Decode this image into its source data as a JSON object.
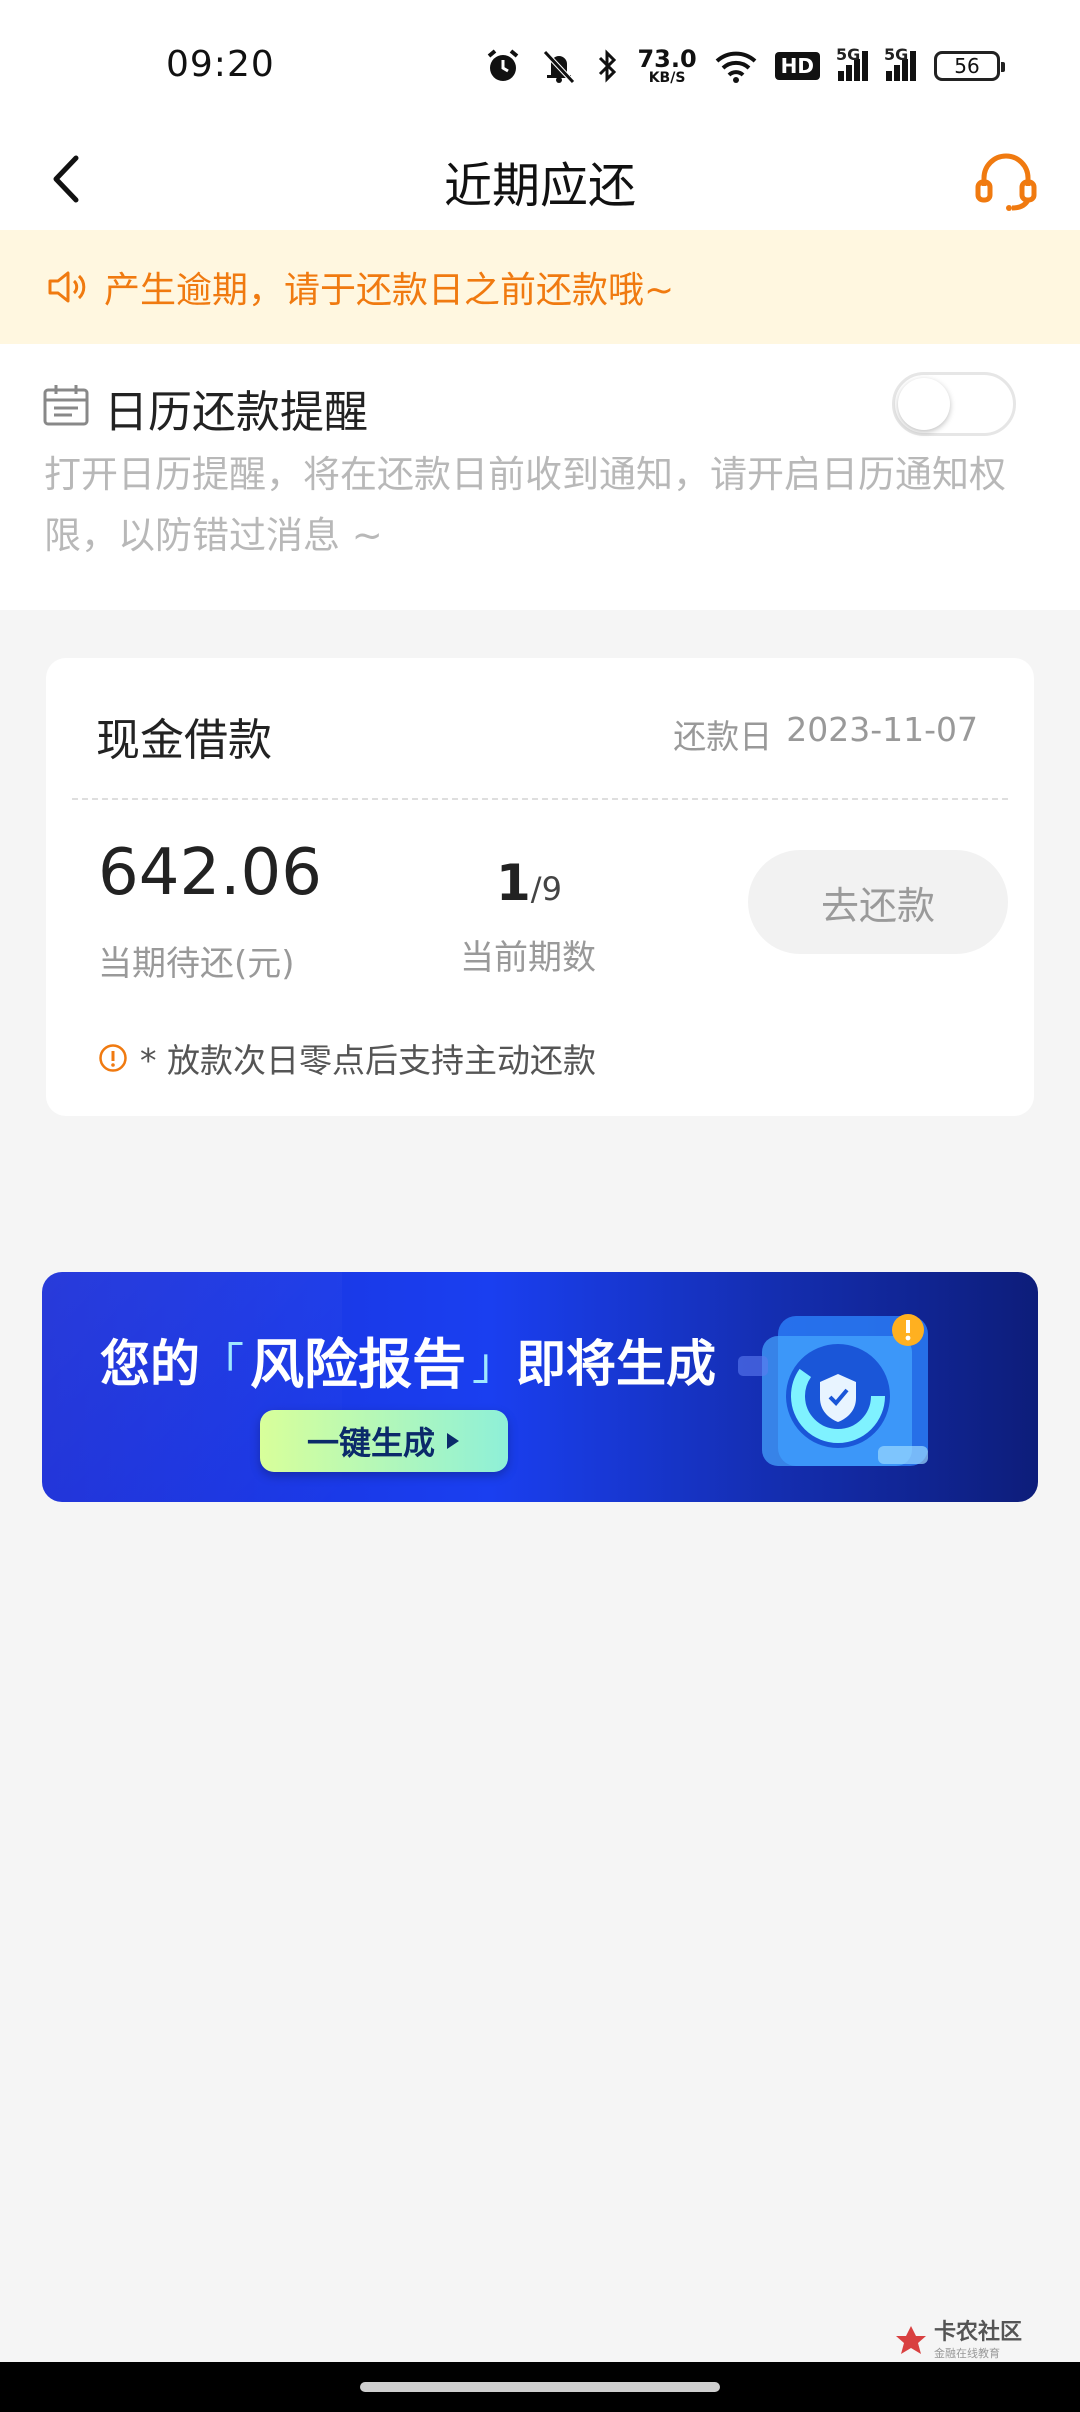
{
  "status_bar": {
    "time": "09:20",
    "net_speed_value": "73.0",
    "net_speed_unit": "KB/S",
    "hd_label": "HD",
    "signal1_label": "5G",
    "signal2_label": "5G",
    "battery": "56",
    "icons": [
      "alarm-icon",
      "mute-icon",
      "bluetooth-icon",
      "wifi-icon"
    ]
  },
  "nav": {
    "title": "近期应还",
    "back_icon": "chevron-left-icon",
    "service_icon": "headset-icon"
  },
  "notice": {
    "icon": "speaker-icon",
    "text": "产生逾期，请于还款日之前还款哦~"
  },
  "reminder": {
    "icon": "calendar-icon",
    "title": "日历还款提醒",
    "description": "打开日历提醒，将在还款日前收到通知，请开启日历通知权限，以防错过消息 ~",
    "enabled": false
  },
  "loan_card": {
    "name": "现金借款",
    "due_label": "还款日",
    "due_date": "2023-11-07",
    "amount": "642.06",
    "amount_label": "当期待还(元)",
    "current_period": "1",
    "period_separator": "/",
    "total_periods": "9",
    "period_label": "当前期数",
    "repay_button": "去还款",
    "tip": "* 放款次日零点后支持主动还款"
  },
  "banner": {
    "prefix": "您的",
    "bracket_open": "「",
    "highlight": "风险报告",
    "bracket_close": "」",
    "suffix": "即将生成",
    "cta_label": "一键生成"
  },
  "watermark": {
    "main": "卡农社区",
    "sub": "金融在线教育"
  },
  "colors": {
    "accent_orange": "#f07a10",
    "notice_bg": "#fff7e0",
    "banner_blue": "#1a3ff0"
  }
}
